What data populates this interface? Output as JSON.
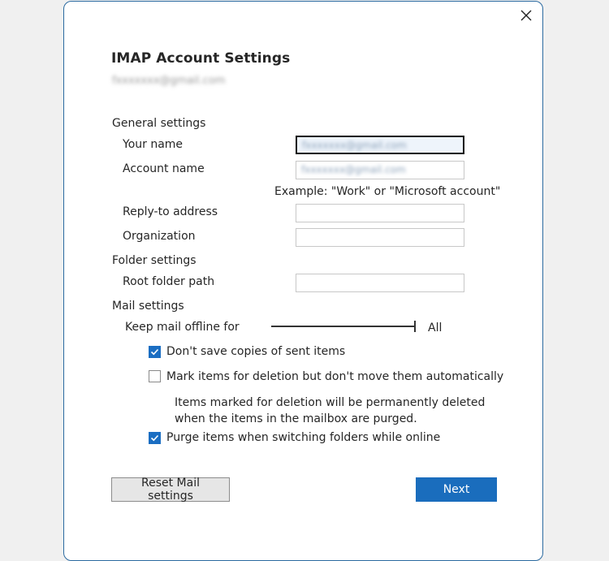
{
  "dialog": {
    "title": "IMAP Account Settings",
    "account_email_blurred": "fxxxxxxx@gmail.com",
    "close_icon": "close-icon"
  },
  "general": {
    "heading": "General settings",
    "your_name_label": "Your name",
    "your_name_value_blurred": "fxxxxxxx@gmail.com",
    "account_name_label": "Account name",
    "account_name_value_blurred": "fxxxxxxx@gmail.com",
    "account_name_hint": "Example: \"Work\" or \"Microsoft account\"",
    "reply_to_label": "Reply-to address",
    "reply_to_value": "",
    "organization_label": "Organization",
    "organization_value": ""
  },
  "folder": {
    "heading": "Folder settings",
    "root_folder_label": "Root folder path",
    "root_folder_value": ""
  },
  "mail": {
    "heading": "Mail settings",
    "keep_offline_label": "Keep mail offline for",
    "keep_offline_value": "All",
    "keep_offline_position": 1.0,
    "checkboxes": [
      {
        "label": "Don't save copies of sent items",
        "checked": true
      },
      {
        "label": "Mark items for deletion but don't move them automatically",
        "checked": false
      },
      {
        "label": "Purge items when switching folders while online",
        "checked": true
      }
    ],
    "deletion_note": "Items marked for deletion will be permanently deleted when the items in the mailbox are purged."
  },
  "buttons": {
    "reset": "Reset Mail settings",
    "next": "Next"
  },
  "colors": {
    "accent": "#1a6dbd",
    "dialog_border": "#2b6aa0",
    "background": "#f0f0f0"
  }
}
